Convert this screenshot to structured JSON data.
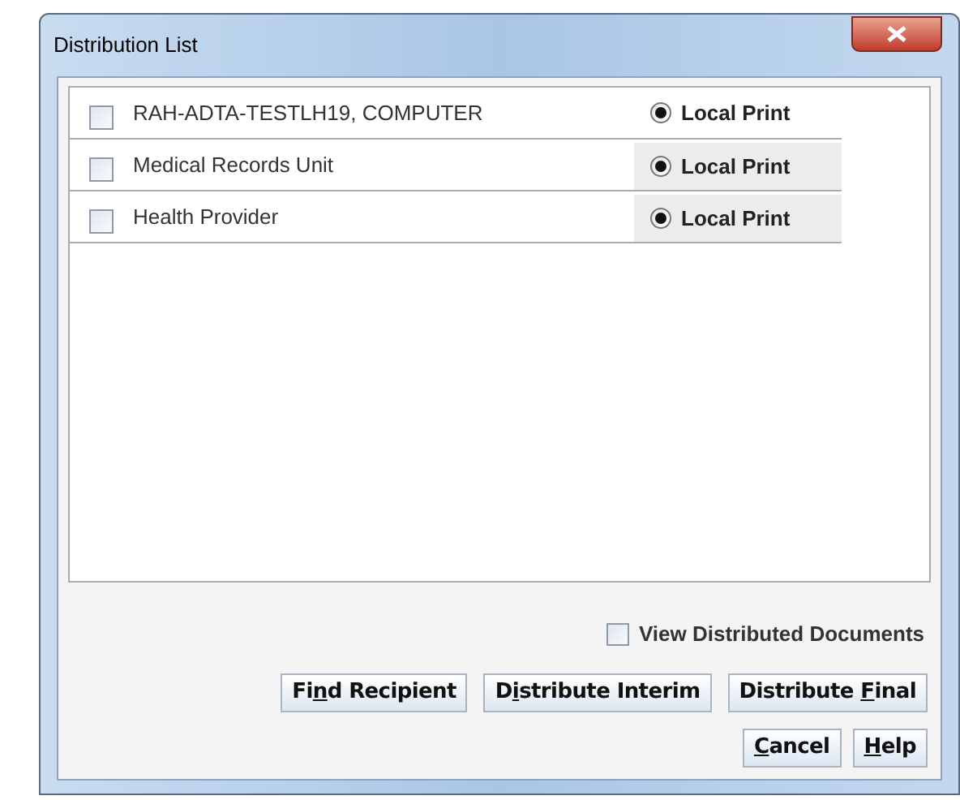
{
  "window": {
    "title": "Distribution List"
  },
  "recipients": [
    {
      "name": "RAH-ADTA-TESTLH19, COMPUTER",
      "checked": false,
      "print_option": "Local Print",
      "print_selected": true,
      "shaded": false
    },
    {
      "name": "Medical Records Unit",
      "checked": false,
      "print_option": "Local Print",
      "print_selected": true,
      "shaded": true
    },
    {
      "name": "Health Provider",
      "checked": false,
      "print_option": "Local Print",
      "print_selected": true,
      "shaded": true
    }
  ],
  "view_distributed": {
    "label": "View Distributed Documents",
    "checked": false
  },
  "action_buttons": [
    {
      "before": "Fi",
      "mnemonic": "n",
      "after": "d Recipient"
    },
    {
      "before": "D",
      "mnemonic": "i",
      "after": "stribute Interim"
    },
    {
      "before": "Distribute ",
      "mnemonic": "F",
      "after": "inal"
    }
  ],
  "dialog_buttons": [
    {
      "mnemonic": "C",
      "after": "ancel"
    },
    {
      "mnemonic": "H",
      "after": "elp"
    }
  ]
}
